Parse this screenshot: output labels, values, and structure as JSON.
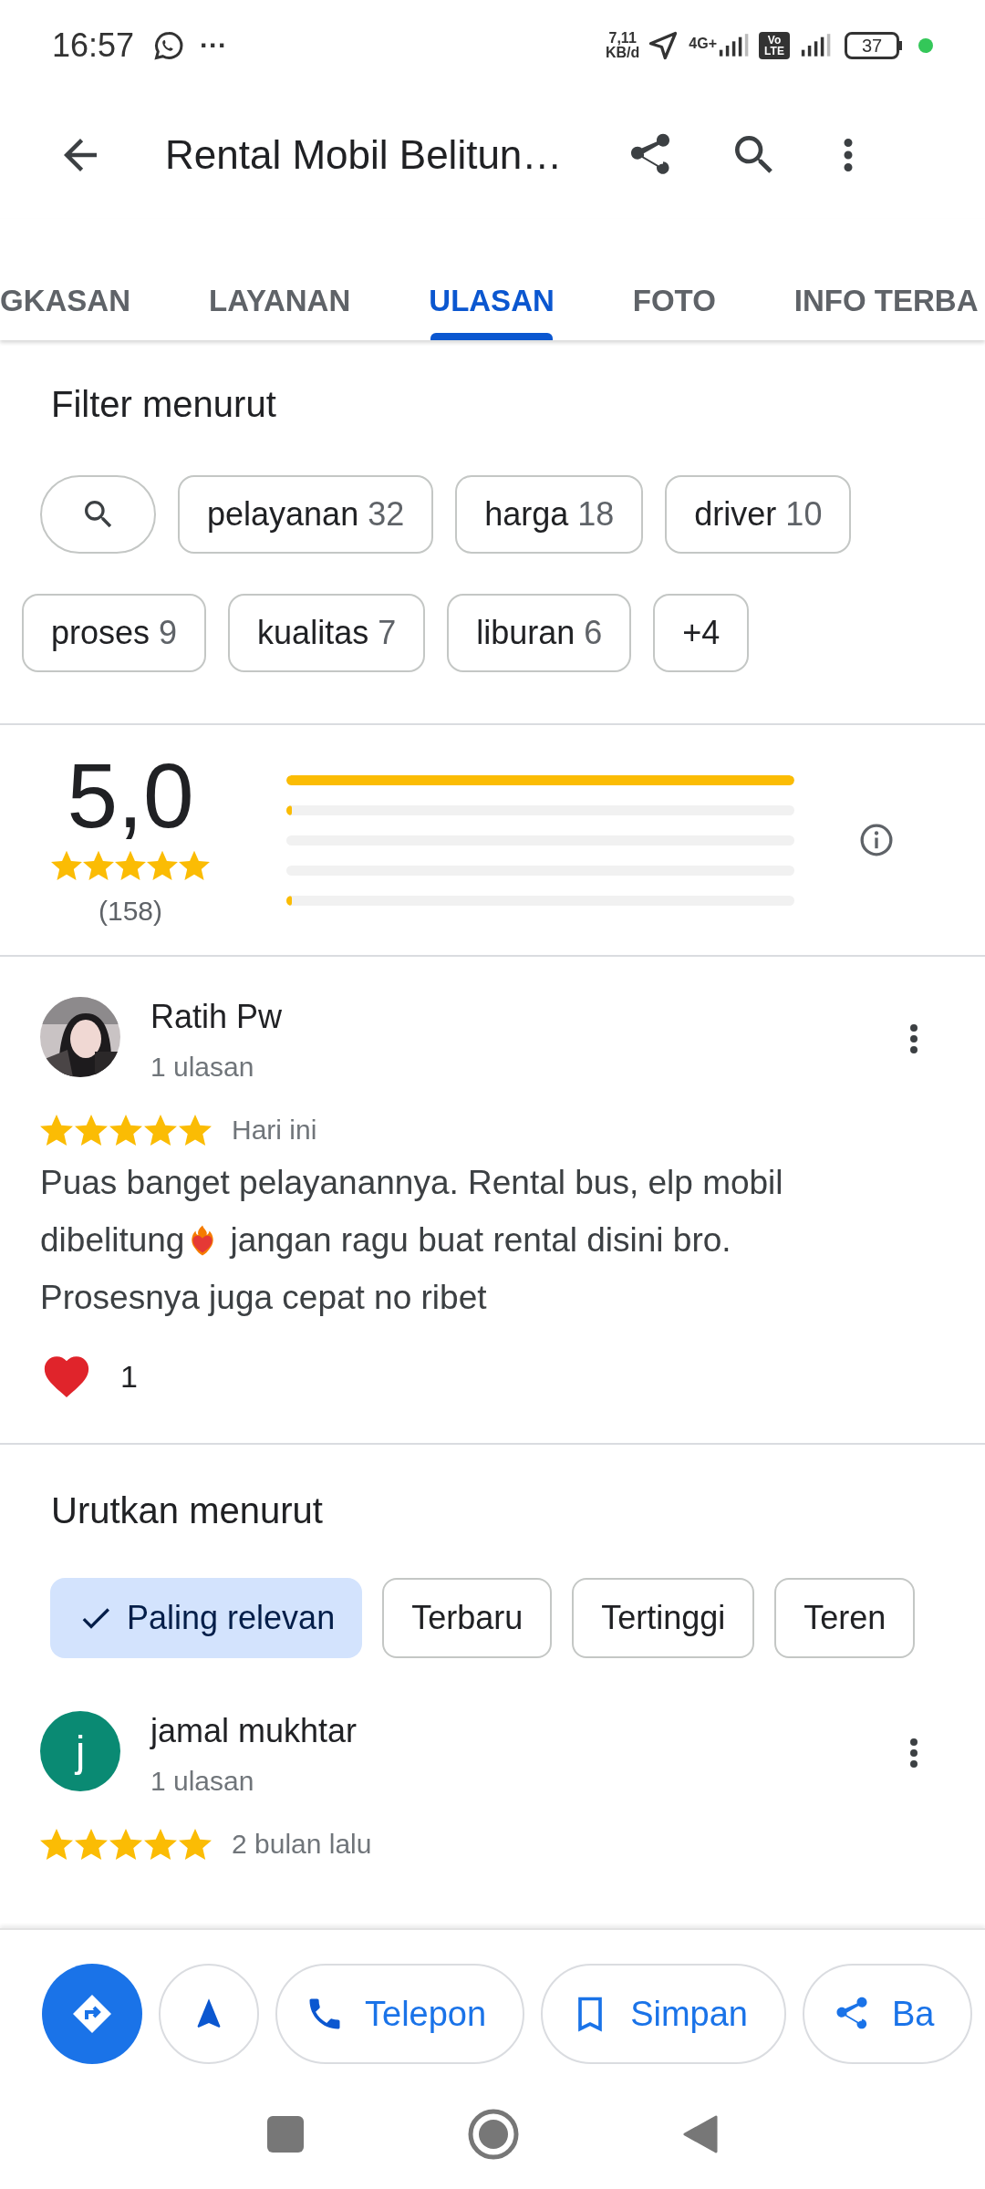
{
  "status_bar": {
    "time": "16:57",
    "more": "···",
    "speed": [
      "7,11",
      "KB/d"
    ],
    "network": "4G+",
    "volte": [
      "Vo",
      "LTE"
    ],
    "battery": "37"
  },
  "app_bar": {
    "title": "Rental Mobil Belitun…"
  },
  "tabs": [
    {
      "label": "GKASAN",
      "selected": false
    },
    {
      "label": "LAYANAN",
      "selected": false
    },
    {
      "label": "ULASAN",
      "selected": true
    },
    {
      "label": "FOTO",
      "selected": false
    },
    {
      "label": "INFO TERBA",
      "selected": false
    }
  ],
  "filter": {
    "title": "Filter menurut",
    "chips": [
      {
        "label": "pelayanan",
        "count": "32"
      },
      {
        "label": "harga",
        "count": "18"
      },
      {
        "label": "driver",
        "count": "10"
      },
      {
        "label": "proses",
        "count": "9"
      },
      {
        "label": "kualitas",
        "count": "7"
      },
      {
        "label": "liburan",
        "count": "6"
      },
      {
        "label": "+4"
      }
    ]
  },
  "rating": {
    "score": "5,0",
    "stars": 5,
    "count": "(158)",
    "bars": [
      {
        "level": 1
      },
      {
        "level": 0.01
      },
      {
        "level": 0
      },
      {
        "level": 0
      },
      {
        "level": 0.01
      }
    ]
  },
  "review": {
    "name": "Ratih Pw",
    "avatar": {
      "kind": "picture"
    },
    "reviews": "1 ulasan",
    "stars": 5,
    "time": "Hari ini",
    "text_lines": [
      [
        {
          "kind": "text",
          "text": "Puas banget pelayanannya. Rental bus, elp mobil"
        }
      ],
      [
        {
          "kind": "text",
          "text": "dibelitung"
        },
        {
          "kind": "emoji"
        },
        {
          "kind": "text",
          "text": "jangan ragu buat rental disini bro."
        }
      ],
      [
        {
          "kind": "text",
          "text": "Prosesnya juga cepat no ribet"
        }
      ]
    ],
    "likes": "1"
  },
  "sort": {
    "title": "Urutkan menurut",
    "options": [
      {
        "label": "Paling relevan",
        "selected": true
      },
      {
        "label": "Terbaru",
        "selected": false
      },
      {
        "label": "Tertinggi",
        "selected": false
      },
      {
        "label": "Teren",
        "selected": false
      }
    ]
  },
  "next_review": {
    "name": "jamal mukhtar",
    "avatar": {
      "kind": "letter",
      "letter": "j",
      "color": "#0a8a73"
    },
    "reviews": "1 ulasan",
    "stars": 5,
    "time": "2 bulan lalu"
  },
  "actions": [
    {
      "kind": "directions"
    },
    {
      "kind": "navigate"
    },
    {
      "kind": "call",
      "label": "Telepon"
    },
    {
      "kind": "save",
      "label": "Simpan"
    },
    {
      "kind": "share",
      "label": "Ba"
    }
  ]
}
